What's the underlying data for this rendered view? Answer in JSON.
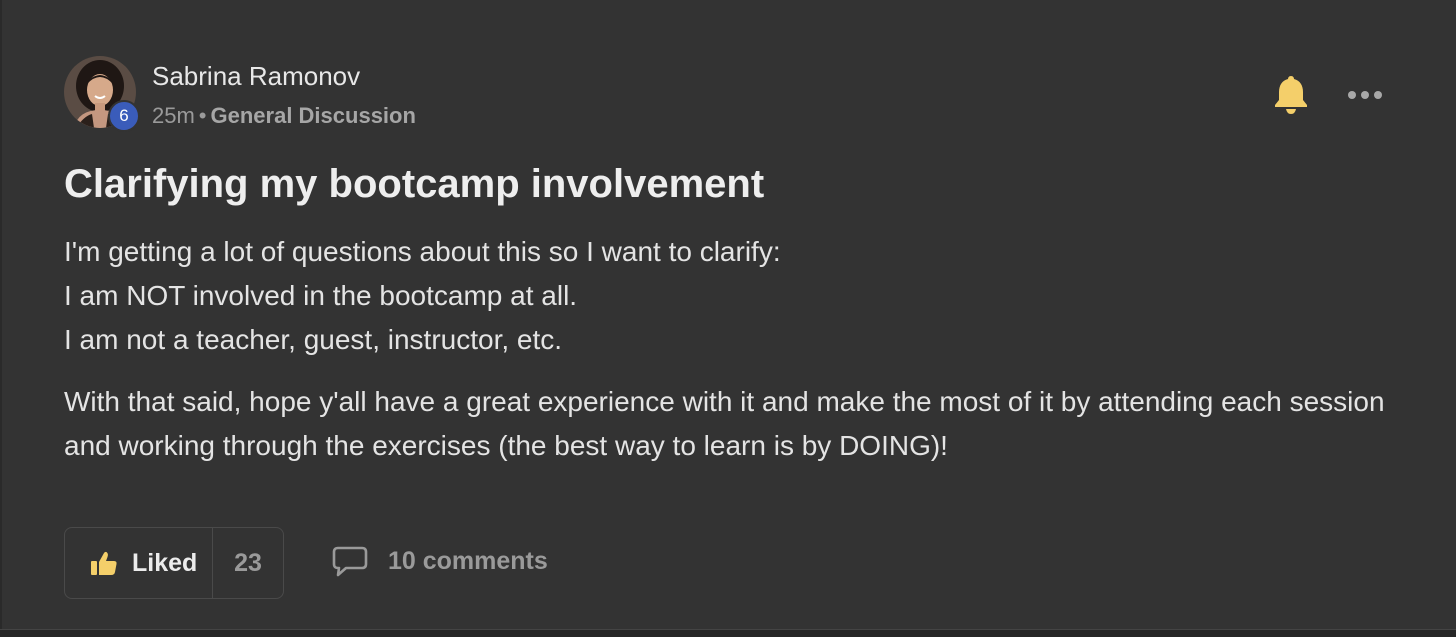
{
  "post": {
    "author": "Sabrina Ramonov",
    "level": "6",
    "time": "25m",
    "separator": "•",
    "category": "General Discussion",
    "title": "Clarifying my bootcamp involvement",
    "body_lines": [
      "I'm getting a lot of questions about this so I want to clarify:",
      "I am NOT involved in the bootcamp at all.",
      "I am not a teacher, guest, instructor, etc."
    ],
    "body_paragraph_2": "With that said, hope y'all have a great experience with it and make the most of it by attending each session and working through the exercises (the best way to learn is by DOING)!"
  },
  "actions": {
    "like_label": "Liked",
    "like_count": "23",
    "comments_label": "10 comments"
  },
  "icons": {
    "bell": "bell-icon",
    "more": "more-options-icon",
    "like": "thumbs-up-icon",
    "comment": "comment-bubble-icon"
  },
  "colors": {
    "card_background": "#333333",
    "bell_accent": "#f4cf6a",
    "level_badge": "#3a5cba",
    "muted_text": "#9a9a9a"
  }
}
